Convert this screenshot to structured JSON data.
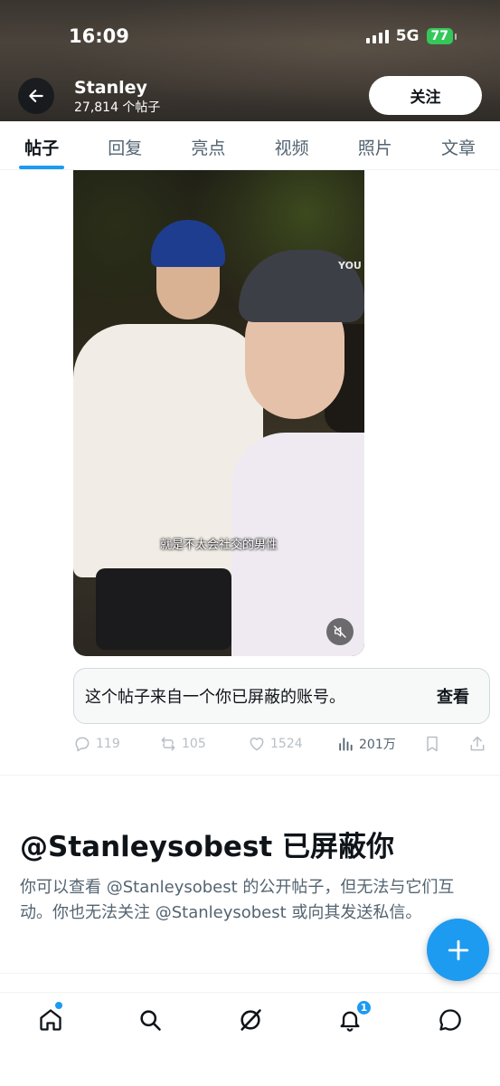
{
  "status_bar": {
    "time": "16:09",
    "network": "5G",
    "battery": "77"
  },
  "header": {
    "name": "Stanley",
    "post_count": "27,814 个帖子",
    "follow_label": "关注"
  },
  "tabs": [
    {
      "label": "帖子",
      "active": true
    },
    {
      "label": "回复",
      "active": false
    },
    {
      "label": "亮点",
      "active": false
    },
    {
      "label": "视频",
      "active": false
    },
    {
      "label": "照片",
      "active": false
    },
    {
      "label": "文章",
      "active": false
    }
  ],
  "media": {
    "subtitle": "就是不太会社交的男性",
    "helmet_brand": "YOU"
  },
  "notice": {
    "text": "这个帖子来自一个你已屏蔽的账号。",
    "view_label": "查看"
  },
  "actions": {
    "replies": "119",
    "reposts": "105",
    "likes": "1524",
    "views": "201万"
  },
  "blocked": {
    "title": "@Stanleysobest 已屏蔽你",
    "description": "你可以查看 @Stanleysobest 的公开帖子，但无法与它们互动。你也无法关注 @Stanleysobest 或向其发送私信。"
  },
  "nav": {
    "notification_count": "1"
  },
  "colors": {
    "accent": "#1d9bf0",
    "text": "#0f1419",
    "secondary": "#536471"
  },
  "icons": [
    "arrow-left-icon",
    "mute-icon",
    "reply-icon",
    "repost-icon",
    "like-icon",
    "views-icon",
    "bookmark-icon",
    "share-icon",
    "plus-icon",
    "home-icon",
    "search-icon",
    "grok-icon",
    "bell-icon",
    "message-icon"
  ]
}
